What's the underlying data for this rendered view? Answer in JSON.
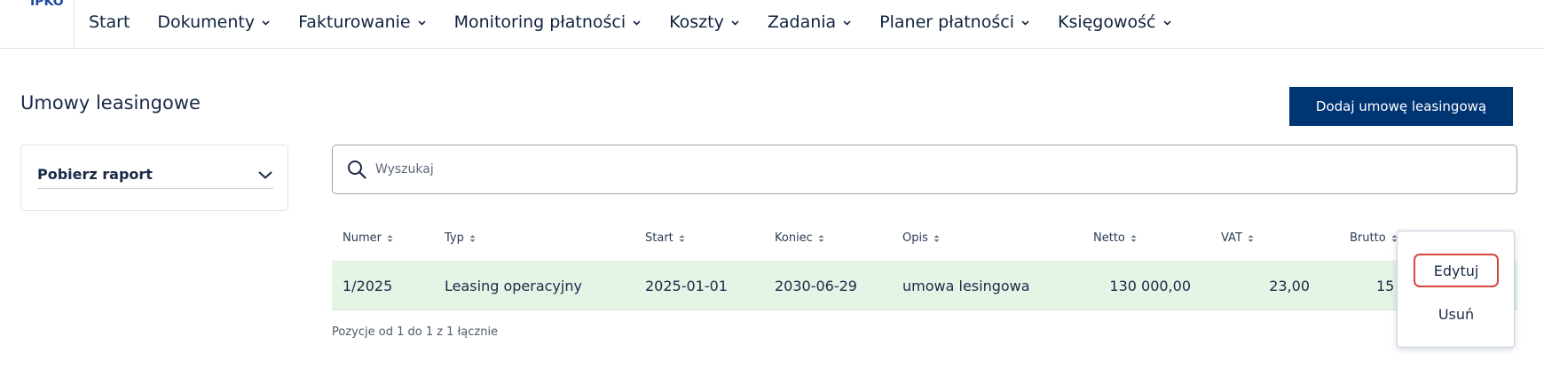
{
  "brand": {
    "logo_text": "IPKO"
  },
  "nav": {
    "items": [
      {
        "label": "Start",
        "has_menu": false
      },
      {
        "label": "Dokumenty",
        "has_menu": true
      },
      {
        "label": "Fakturowanie",
        "has_menu": true
      },
      {
        "label": "Monitoring płatności",
        "has_menu": true
      },
      {
        "label": "Koszty",
        "has_menu": true
      },
      {
        "label": "Zadania",
        "has_menu": true
      },
      {
        "label": "Planer płatności",
        "has_menu": true
      },
      {
        "label": "Księgowość",
        "has_menu": true
      }
    ]
  },
  "page": {
    "title": "Umowy leasingowe",
    "add_button": "Dodaj umowę leasingową"
  },
  "report": {
    "label": "Pobierz raport"
  },
  "search": {
    "placeholder": "Wyszukaj",
    "value": ""
  },
  "table": {
    "columns": [
      "Numer",
      "Typ",
      "Start",
      "Koniec",
      "Opis",
      "Netto",
      "VAT",
      "Brutto"
    ],
    "rows": [
      {
        "numer": "1/2025",
        "typ": "Leasing operacyjny",
        "start": "2025-01-01",
        "koniec": "2030-06-29",
        "opis": "umowa lesingowa",
        "netto": "130 000,00",
        "vat": "23,00",
        "brutto": "15"
      }
    ],
    "footer": "Pozycje od 1 do 1 z 1 łącznie"
  },
  "context_menu": {
    "edit": "Edytuj",
    "delete": "Usuń"
  },
  "colors": {
    "primary": "#003574",
    "row_highlight": "#e6f4e6",
    "focus_outline": "#d9443c"
  }
}
